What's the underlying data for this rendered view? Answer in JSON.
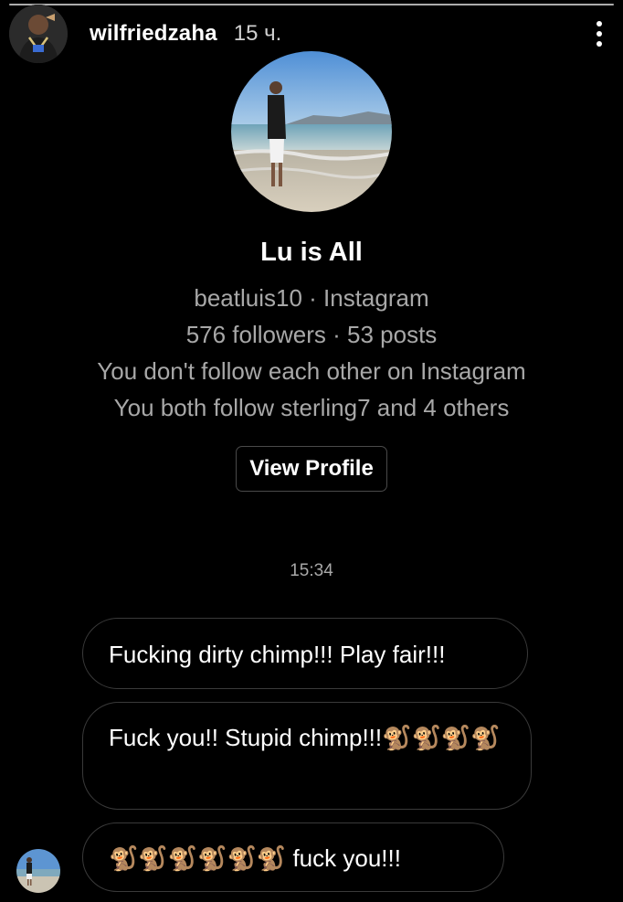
{
  "story": {
    "username": "wilfriedzaha",
    "time_ago": "15 ч.",
    "progress": 1.0
  },
  "shared_profile": {
    "name": "Lu is All",
    "handle_line": "beatluis10 · Instagram",
    "stats_line": "576 followers · 53 posts",
    "follow_status": "You don't follow each other on Instagram",
    "mutuals": "You both follow sterling7 and 4 others",
    "view_profile_label": "View Profile"
  },
  "conversation": {
    "timestamp": "15:34",
    "messages": [
      "Fucking dirty chimp!!! Play fair!!!",
      "Fuck you!! Stupid chimp!!!🐒🐒🐒🐒",
      "🐒🐒🐒🐒🐒🐒 fuck you!!!"
    ]
  },
  "icons": {
    "more": "more-vertical-icon"
  }
}
